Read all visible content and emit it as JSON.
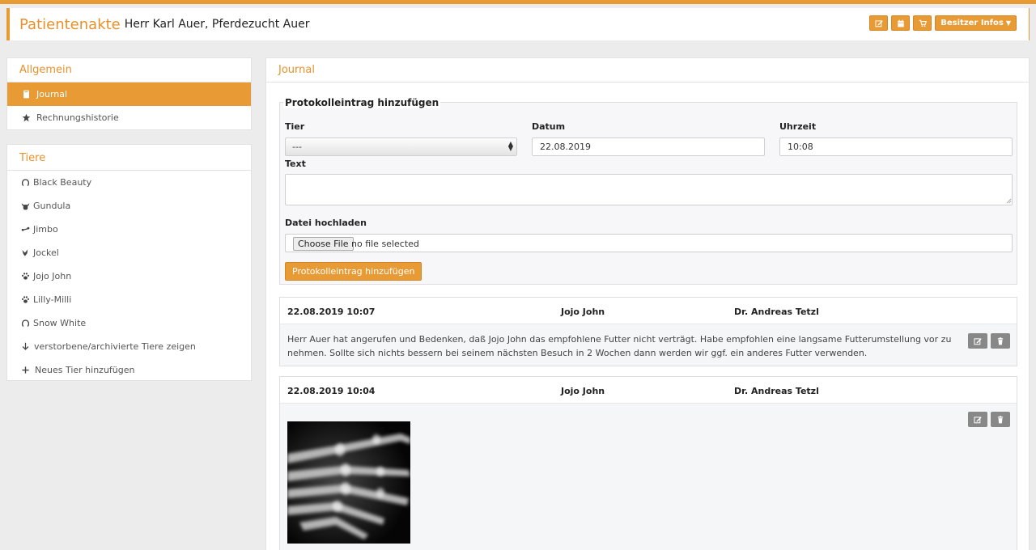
{
  "header": {
    "title": "Patientenakte",
    "owner": "Herr Karl Auer, Pferdezucht Auer",
    "buttons": {
      "edit_icon": "edit-icon",
      "calendar_icon": "calendar-icon",
      "cart_icon": "cart-icon",
      "owner_info_label": "Besitzer Infos"
    }
  },
  "colors": {
    "accent": "#e89a35",
    "accent_text": "#e8912c",
    "muted_button": "#888888"
  },
  "sidebar": {
    "general": {
      "heading": "Allgemein",
      "items": [
        {
          "label": "Journal",
          "icon": "book-icon",
          "active": true
        },
        {
          "label": "Rechnungshistorie",
          "icon": "star-icon",
          "active": false
        }
      ]
    },
    "animals": {
      "heading": "Tiere",
      "items": [
        {
          "label": "Black Beauty",
          "icon": "horseshoe-icon"
        },
        {
          "label": "Gundula",
          "icon": "cow-icon"
        },
        {
          "label": "Jimbo",
          "icon": "bone-icon"
        },
        {
          "label": "Jockel",
          "icon": "bird-icon"
        },
        {
          "label": "Jojo John",
          "icon": "paw-icon"
        },
        {
          "label": "Lilly-Milli",
          "icon": "paw-icon"
        },
        {
          "label": "Snow White",
          "icon": "horseshoe-icon"
        },
        {
          "label": "verstorbene/archivierte Tiere zeigen",
          "icon": "arrow-down-icon"
        },
        {
          "label": "Neues Tier hinzufügen",
          "icon": "plus-icon"
        }
      ]
    }
  },
  "main": {
    "heading": "Journal",
    "form": {
      "legend": "Protokolleintrag hinzufügen",
      "animal_label": "Tier",
      "animal_value": "---",
      "date_label": "Datum",
      "date_value": "22.08.2019",
      "time_label": "Uhrzeit",
      "time_value": "10:08",
      "text_label": "Text",
      "text_value": "",
      "upload_label": "Datei hochladen",
      "file_button": "Choose File",
      "file_status": "no file selected",
      "submit_label": "Protokolleintrag hinzufügen"
    },
    "entries": [
      {
        "datetime": "22.08.2019 10:07",
        "animal": "Jojo John",
        "doctor": "Dr. Andreas Tetzl",
        "text": "Herr Auer hat angerufen und Bedenken, daß Jojo John das empfohlene Futter nicht verträgt. Habe empfohlen eine langsame Futterumstellung vor zu nehmen. Sollte sich nichts bessern bei seinem nächsten Besuch in 2 Wochen dann werden wir ggf. ein anderes Futter verwenden."
      },
      {
        "datetime": "22.08.2019 10:04",
        "animal": "Jojo John",
        "doctor": "Dr. Andreas Tetzl",
        "attachment": "x-ray-image"
      }
    ]
  }
}
